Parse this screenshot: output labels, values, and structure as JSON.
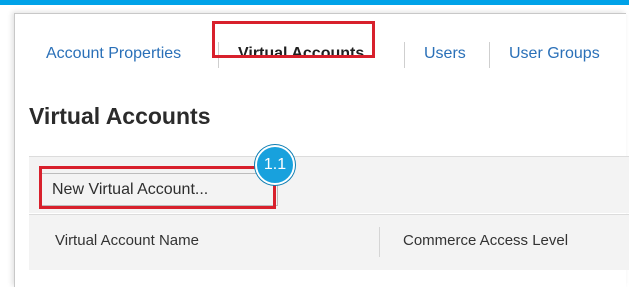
{
  "tabs": {
    "account_properties": "Account Properties",
    "virtual_accounts": "Virtual Accounts",
    "users": "Users",
    "user_groups": "User Groups"
  },
  "page": {
    "title": "Virtual Accounts"
  },
  "toolbar": {
    "new_virtual_account": "New Virtual Account..."
  },
  "callout": {
    "step": "1.1"
  },
  "table": {
    "columns": [
      "Virtual Account Name",
      "Commerce Access Level"
    ]
  },
  "colors": {
    "highlight": "#d8202c",
    "link": "#2a70b8",
    "badge": "#18a1dd",
    "accent_bar": "#00a2e8"
  }
}
